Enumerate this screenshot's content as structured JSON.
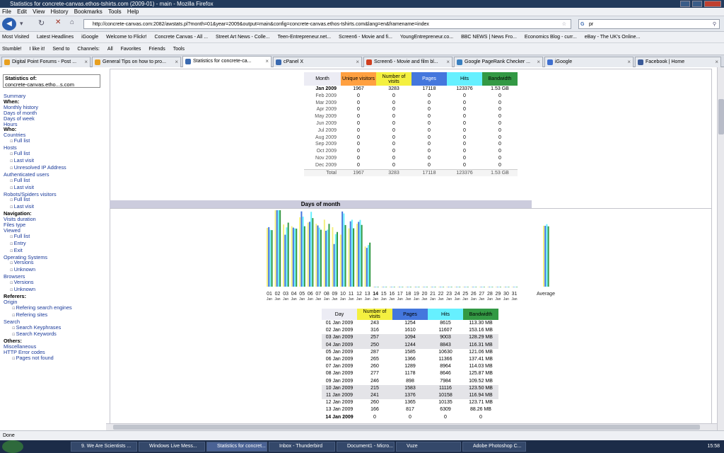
{
  "window": {
    "title": "Statistics for concrete-canvas.ethos-tshirts.com (2009-01) - main - Mozilla Firefox"
  },
  "menu": [
    "File",
    "Edit",
    "View",
    "History",
    "Bookmarks",
    "Tools",
    "Help"
  ],
  "nav": {
    "url": "http://concrete-canvas.com:2082/awstats.pl?month=01&year=2009&output=main&config=concrete-canvas.ethos-tshirts.com&lang=en&framename=index",
    "search_value": "pr"
  },
  "bookmarks": [
    "Most Visited",
    "Latest Headlines",
    "iGoogle",
    "Welcome to Flickr!",
    "Concrete Canvas - All ...",
    "Street Art News - Colle...",
    "Teen-Entrepreneur.net...",
    "Screen6 - Movie and fi...",
    "YoungEntrepreneur.co...",
    "BBC NEWS | News Fro...",
    "Economics Blog - curr...",
    "eBay - The UK's Online..."
  ],
  "toolbar2": [
    "Stumble!",
    "I like it!",
    "Send to",
    "Channels:",
    "All",
    "Favorites",
    "Friends",
    "Tools"
  ],
  "tabs": [
    {
      "label": "Digital Point Forums - Post ...",
      "color": "#e8a020"
    },
    {
      "label": "General Tips on how to pro...",
      "color": "#e8a020"
    },
    {
      "label": "Statistics for concrete-ca...",
      "color": "#3a6ab0"
    },
    {
      "label": "cPanel X",
      "color": "#3a6ab0"
    },
    {
      "label": "Screen6 - Movie and film bl...",
      "color": "#d04020"
    },
    {
      "label": "Google PageRank Checker ...",
      "color": "#3a80c0"
    },
    {
      "label": "iGoogle",
      "color": "#4070d0"
    },
    {
      "label": "Facebook | Home",
      "color": "#3a5a98"
    }
  ],
  "sidebar": {
    "stats_label": "Statistics of:",
    "stats_domain": "concrete-canvas.etho...s.com",
    "items": [
      {
        "t": "Summary",
        "k": "lk"
      },
      {
        "t": "When:",
        "k": "hd"
      },
      {
        "t": "Monthly history",
        "k": "lk"
      },
      {
        "t": "Days of month",
        "k": "lk"
      },
      {
        "t": "Days of week",
        "k": "lk"
      },
      {
        "t": "Hours",
        "k": "lk"
      },
      {
        "t": "Who:",
        "k": "hd"
      },
      {
        "t": "Countries",
        "k": "lk"
      },
      {
        "t": "Full list",
        "k": "sub"
      },
      {
        "t": "Hosts",
        "k": "lk"
      },
      {
        "t": "Full list",
        "k": "sub"
      },
      {
        "t": "Last visit",
        "k": "sub"
      },
      {
        "t": "Unresolved IP Address",
        "k": "sub"
      },
      {
        "t": "Authenticated users",
        "k": "lk"
      },
      {
        "t": "Full list",
        "k": "sub"
      },
      {
        "t": "Last visit",
        "k": "sub"
      },
      {
        "t": "Robots/Spiders visitors",
        "k": "lk"
      },
      {
        "t": "Full list",
        "k": "sub"
      },
      {
        "t": "Last visit",
        "k": "sub"
      },
      {
        "t": "Navigation:",
        "k": "hd"
      },
      {
        "t": "Visits duration",
        "k": "lk"
      },
      {
        "t": "Files type",
        "k": "lk"
      },
      {
        "t": "Viewed",
        "k": "lk"
      },
      {
        "t": "Full list",
        "k": "sub"
      },
      {
        "t": "Entry",
        "k": "sub"
      },
      {
        "t": "Exit",
        "k": "sub"
      },
      {
        "t": "Operating Systems",
        "k": "lk"
      },
      {
        "t": "Versions",
        "k": "sub"
      },
      {
        "t": "Unknown",
        "k": "sub"
      },
      {
        "t": "Browsers",
        "k": "lk"
      },
      {
        "t": "Versions",
        "k": "sub"
      },
      {
        "t": "Unknown",
        "k": "sub"
      },
      {
        "t": "Referers:",
        "k": "hd"
      },
      {
        "t": "Origin",
        "k": "lk"
      },
      {
        "t": "Refering search engines",
        "k": "sub2"
      },
      {
        "t": "Refering sites",
        "k": "sub2"
      },
      {
        "t": "Search",
        "k": "lk"
      },
      {
        "t": "Search Keyphrases",
        "k": "sub2"
      },
      {
        "t": "Search Keywords",
        "k": "sub2"
      },
      {
        "t": "Others:",
        "k": "hd"
      },
      {
        "t": "Miscellaneous",
        "k": "lk"
      },
      {
        "t": "HTTP Error codes",
        "k": "lk"
      },
      {
        "t": "Pages not found",
        "k": "sub2"
      }
    ]
  },
  "monthly": {
    "headers": [
      "Month",
      "Unique visitors",
      "Number of visits",
      "Pages",
      "Hits",
      "Bandwidth"
    ],
    "header_colors": [
      "#ececf4",
      "#ffa040",
      "#f4f040",
      "#4477dd",
      "#66f0ff",
      "#339944"
    ],
    "rows": [
      [
        "Jan 2009",
        "1967",
        "3283",
        "17118",
        "123376",
        "1.53 GB"
      ],
      [
        "Feb 2009",
        "0",
        "0",
        "0",
        "0",
        "0"
      ],
      [
        "Mar 2009",
        "0",
        "0",
        "0",
        "0",
        "0"
      ],
      [
        "Apr 2009",
        "0",
        "0",
        "0",
        "0",
        "0"
      ],
      [
        "May 2009",
        "0",
        "0",
        "0",
        "0",
        "0"
      ],
      [
        "Jun 2009",
        "0",
        "0",
        "0",
        "0",
        "0"
      ],
      [
        "Jul 2009",
        "0",
        "0",
        "0",
        "0",
        "0"
      ],
      [
        "Aug 2009",
        "0",
        "0",
        "0",
        "0",
        "0"
      ],
      [
        "Sep 2009",
        "0",
        "0",
        "0",
        "0",
        "0"
      ],
      [
        "Oct 2009",
        "0",
        "0",
        "0",
        "0",
        "0"
      ],
      [
        "Nov 2009",
        "0",
        "0",
        "0",
        "0",
        "0"
      ],
      [
        "Dec 2009",
        "0",
        "0",
        "0",
        "0",
        "0"
      ]
    ],
    "total": [
      "Total",
      "1967",
      "3283",
      "17118",
      "123376",
      "1.53 GB"
    ]
  },
  "days_title": "Days of month",
  "chart_data": {
    "type": "bar",
    "categories": [
      "01",
      "02",
      "03",
      "04",
      "05",
      "06",
      "07",
      "08",
      "09",
      "10",
      "11",
      "12",
      "13",
      "14",
      "15",
      "16",
      "17",
      "18",
      "19",
      "20",
      "21",
      "22",
      "23",
      "24",
      "25",
      "26",
      "27",
      "28",
      "29",
      "30",
      "31",
      "Average"
    ],
    "sub_labels": [
      "Jan",
      "Jan",
      "Jan",
      "Jan",
      "Jan",
      "Jan",
      "Jan",
      "Jan",
      "Jan",
      "Jan",
      "Jan",
      "Jan",
      "Jan",
      "Jan",
      "Jan",
      "Jan",
      "Jan",
      "Jan",
      "Jan",
      "Jan",
      "Jan",
      "Jan",
      "Jan",
      "Jan",
      "Jan",
      "Jan",
      "Jan",
      "Jan",
      "Jan",
      "Jan",
      "Jan",
      ""
    ],
    "series": [
      {
        "color": "#f4f080",
        "values": [
          243,
          316,
          257,
          250,
          287,
          265,
          260,
          277,
          246,
          215,
          241,
          260,
          166,
          0,
          0,
          0,
          0,
          0,
          0,
          0,
          0,
          0,
          0,
          0,
          0,
          0,
          0,
          0,
          0,
          0,
          0,
          252
        ]
      },
      {
        "color": "#4477dd",
        "values": [
          1254,
          1610,
          1094,
          1244,
          1585,
          1366,
          1289,
          1178,
          898,
          1583,
          1376,
          1365,
          817,
          0,
          0,
          0,
          0,
          0,
          0,
          0,
          0,
          0,
          0,
          0,
          0,
          0,
          0,
          0,
          0,
          0,
          0,
          1281
        ]
      },
      {
        "color": "#66f0ff",
        "values": [
          8615,
          11607,
          9003,
          8843,
          10630,
          11366,
          8964,
          8646,
          7984,
          11116,
          10158,
          10135,
          6309,
          0,
          0,
          0,
          0,
          0,
          0,
          0,
          0,
          0,
          0,
          0,
          0,
          0,
          0,
          0,
          0,
          0,
          0,
          9490
        ]
      },
      {
        "color": "#339944",
        "values": [
          113.3,
          153.16,
          128.29,
          116.31,
          121.06,
          137.41,
          114.03,
          125.87,
          109.52,
          123.5,
          116.94,
          123.71,
          88.26,
          0,
          0,
          0,
          0,
          0,
          0,
          0,
          0,
          0,
          0,
          0,
          0,
          0,
          0,
          0,
          0,
          0,
          0,
          120.88
        ]
      }
    ]
  },
  "daily": {
    "headers": [
      "Day",
      "Number of visits",
      "Pages",
      "Hits",
      "Bandwidth"
    ],
    "header_colors": [
      "#ececf4",
      "#f4f040",
      "#4477dd",
      "#66f0ff",
      "#339944"
    ],
    "rows": [
      [
        "01 Jan 2009",
        "243",
        "1254",
        "8615",
        "113.30 MB"
      ],
      [
        "02 Jan 2009",
        "316",
        "1610",
        "11607",
        "153.16 MB"
      ],
      [
        "03 Jan 2009",
        "257",
        "1094",
        "9003",
        "128.29 MB"
      ],
      [
        "04 Jan 2009",
        "250",
        "1244",
        "8843",
        "116.31 MB"
      ],
      [
        "05 Jan 2009",
        "287",
        "1585",
        "10630",
        "121.06 MB"
      ],
      [
        "06 Jan 2009",
        "265",
        "1366",
        "11366",
        "137.41 MB"
      ],
      [
        "07 Jan 2009",
        "260",
        "1289",
        "8964",
        "114.03 MB"
      ],
      [
        "08 Jan 2009",
        "277",
        "1178",
        "8646",
        "125.87 MB"
      ],
      [
        "09 Jan 2009",
        "246",
        "898",
        "7984",
        "109.52 MB"
      ],
      [
        "10 Jan 2009",
        "215",
        "1583",
        "11116",
        "123.50 MB"
      ],
      [
        "11 Jan 2009",
        "241",
        "1376",
        "10158",
        "116.94 MB"
      ],
      [
        "12 Jan 2009",
        "260",
        "1365",
        "10135",
        "123.71 MB"
      ],
      [
        "13 Jan 2009",
        "166",
        "817",
        "6309",
        "88.26 MB"
      ],
      [
        "14 Jan 2009",
        "0",
        "0",
        "0",
        "0"
      ]
    ],
    "weekend_rows": [
      2,
      3,
      9,
      10
    ]
  },
  "status": "Done",
  "taskbar": [
    {
      "label": "9. We Are Scientists ..."
    },
    {
      "label": "Windows Live Mess..."
    },
    {
      "label": "Statistics for concret..."
    },
    {
      "label": "Inbox - Thunderbird"
    },
    {
      "label": "Document1 - Micro..."
    },
    {
      "label": "Vuze"
    },
    {
      "label": "Adobe Photoshop C..."
    }
  ],
  "clock": "15:58"
}
